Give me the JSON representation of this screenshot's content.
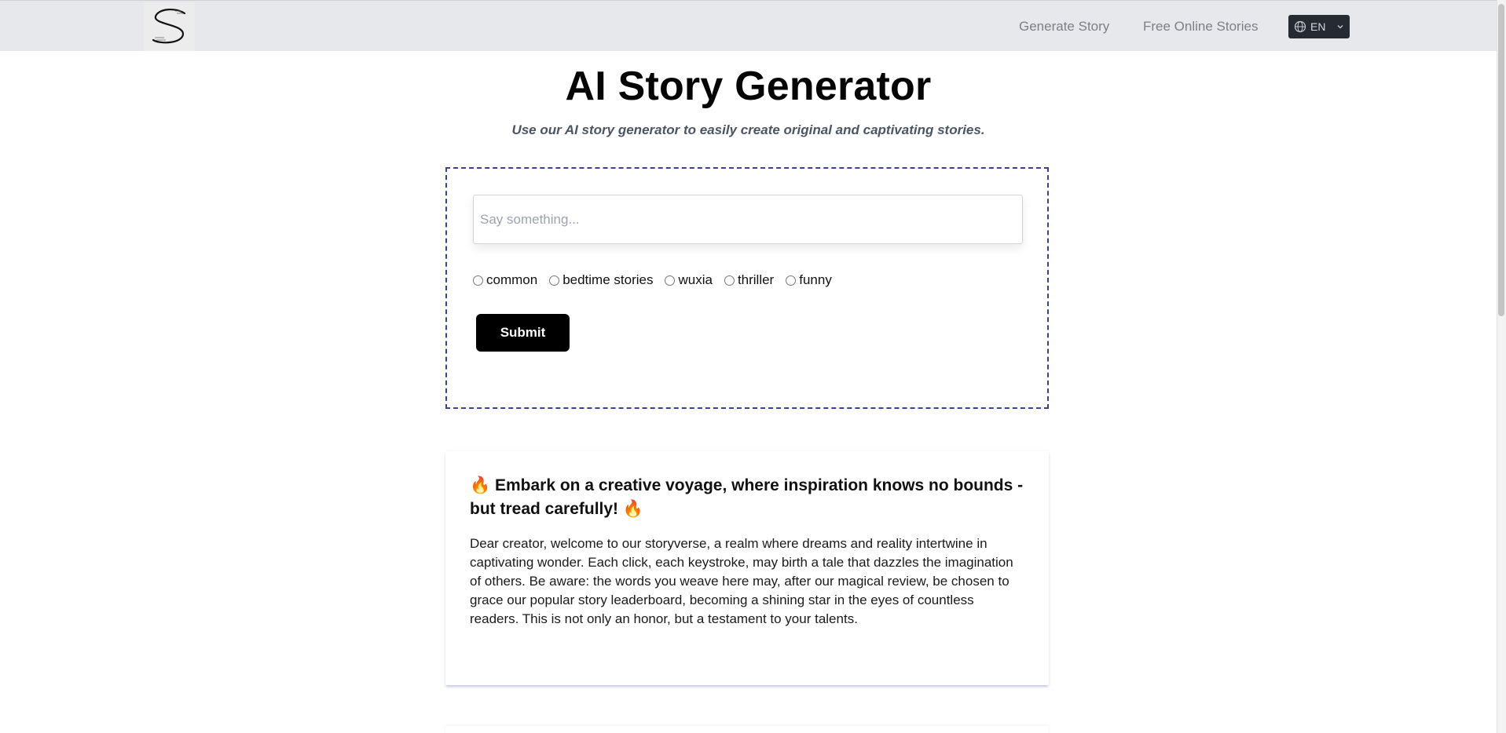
{
  "header": {
    "nav": [
      {
        "label": "Generate Story"
      },
      {
        "label": "Free Online Stories"
      }
    ],
    "language": {
      "label": "EN",
      "icon": "globe-icon"
    }
  },
  "hero": {
    "title": "AI Story Generator",
    "subtitle": "Use our AI story generator to easily create original and captivating stories."
  },
  "form": {
    "input_placeholder": "Say something...",
    "input_value": "",
    "styles": [
      {
        "label": "common"
      },
      {
        "label": "bedtime stories"
      },
      {
        "label": "wuxia"
      },
      {
        "label": "thriller"
      },
      {
        "label": "funny"
      }
    ],
    "submit_label": "Submit"
  },
  "notice": {
    "title": "🔥 Embark on a creative voyage, where inspiration knows no bounds - but tread carefully! 🔥",
    "body": "Dear creator, welcome to our storyverse, a realm where dreams and reality intertwine in captivating wonder. Each click, each keystroke, may birth a tale that dazzles the imagination of others. Be aware: the words you weave here may, after our magical review, be chosen to grace our popular story leaderboard, becoming a shining star in the eyes of countless readers. This is not only an honor, but a testament to your talents."
  },
  "colors": {
    "header_bg": "#e7e8eb",
    "form_border": "#3b3e9a",
    "button_bg": "#000000",
    "lang_bg": "#262a33"
  }
}
